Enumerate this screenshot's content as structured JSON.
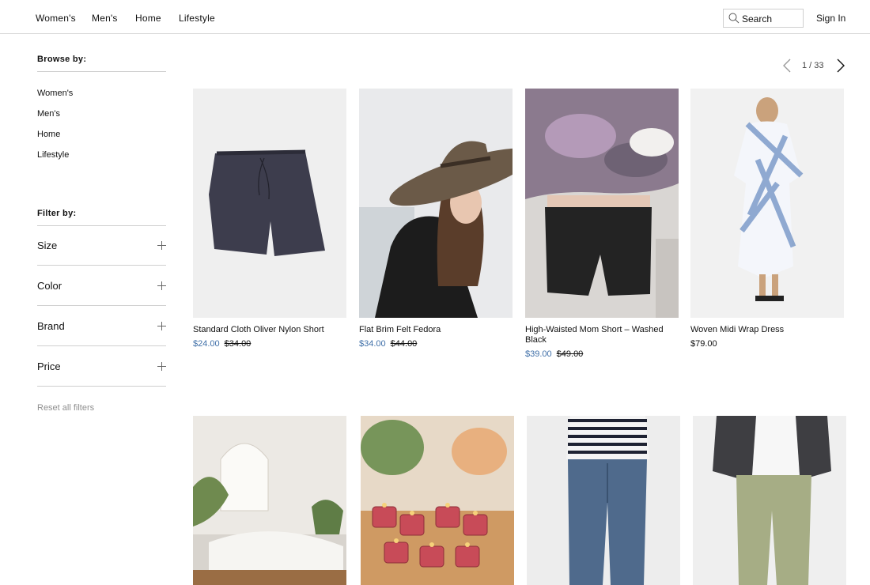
{
  "nav": {
    "links": [
      "Women's",
      "Men's",
      "Home",
      "Lifestyle"
    ],
    "search_label": "Search",
    "sign_in": "Sign In"
  },
  "sidebar": {
    "browse_heading": "Browse by:",
    "browse_items": [
      "Women's",
      "Men's",
      "Home",
      "Lifestyle"
    ],
    "filter_heading": "Filter by:",
    "filters": [
      "Size",
      "Color",
      "Brand",
      "Price"
    ],
    "reset": "Reset all filters"
  },
  "pager": {
    "text": "1 / 33"
  },
  "colors": {
    "sale_price": "#3f6fa8",
    "rule": "#cfcfcf"
  },
  "products": [
    {
      "name": "Standard Cloth Oliver Nylon Short",
      "sale": "$24.00",
      "original": "$34.00"
    },
    {
      "name": "Flat Brim Felt Fedora",
      "sale": "$34.00",
      "original": "$44.00"
    },
    {
      "name": "High-Waisted Mom Short – Washed Black",
      "sale": "$39.00",
      "original": "$49.00"
    },
    {
      "name": "Woven Midi Wrap Dress",
      "price": "$79.00"
    }
  ]
}
